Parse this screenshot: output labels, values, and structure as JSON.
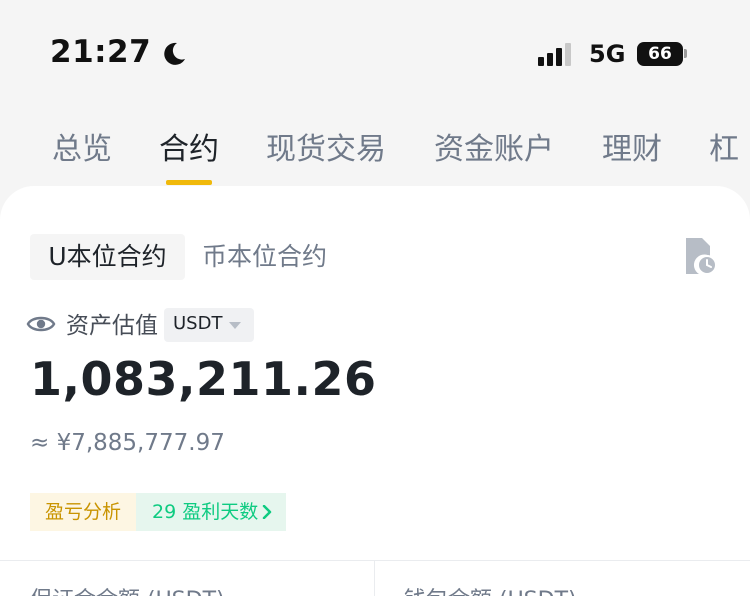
{
  "status_bar": {
    "time": "21:27",
    "network": "5G",
    "battery": "66",
    "icons": [
      "moon-icon",
      "signal-icon",
      "battery-icon"
    ]
  },
  "tabs": [
    {
      "label": "总览"
    },
    {
      "label": "合约"
    },
    {
      "label": "现货交易"
    },
    {
      "label": "资金账户"
    },
    {
      "label": "理财"
    },
    {
      "label": "杠"
    }
  ],
  "active_tab": "合约",
  "contract_type": {
    "active": "U本位合约",
    "inactive": "币本位合约"
  },
  "asset": {
    "label": "资产估值",
    "unit": "USDT",
    "balance": "1,083,211.26",
    "balance_cny": "≈ ¥7,885,777.97"
  },
  "analysis": {
    "pnl_label": "盈亏分析",
    "profit_days": "29 盈利天数"
  },
  "footer": {
    "margin_label": "保证金余额 (USDT)",
    "wallet_label": "钱包余额 (USDT)"
  },
  "colors": {
    "accent": "#f0b90b",
    "profit_green": "#0ecb81",
    "pnl_gold": "#c99400",
    "text_primary": "#1e2329",
    "text_secondary": "#707a8a"
  }
}
